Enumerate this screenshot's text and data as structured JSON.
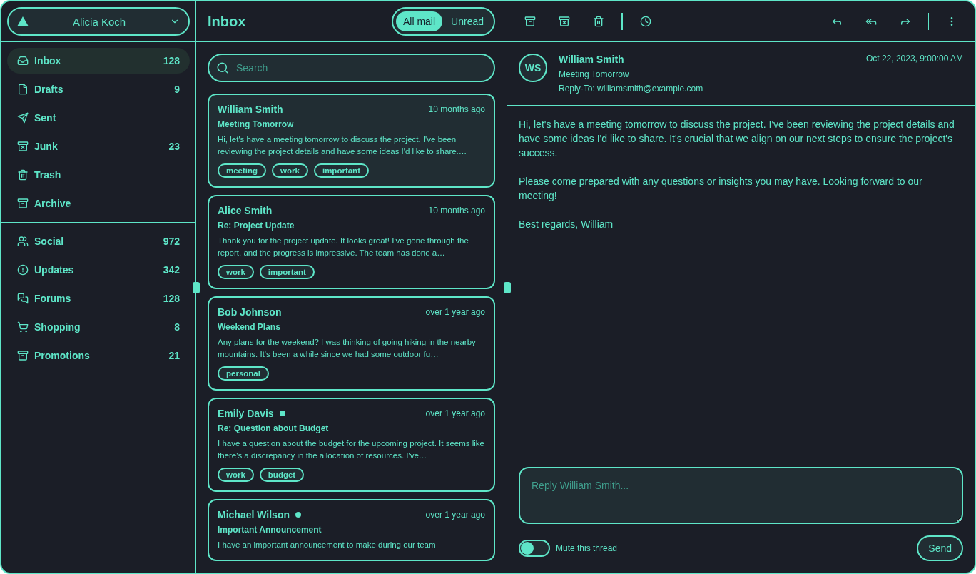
{
  "account": {
    "name": "Alicia Koch"
  },
  "nav_primary": [
    {
      "label": "Inbox",
      "count": "128",
      "selected": true
    },
    {
      "label": "Drafts",
      "count": "9",
      "selected": false
    },
    {
      "label": "Sent",
      "selected": false
    },
    {
      "label": "Junk",
      "count": "23",
      "selected": false
    },
    {
      "label": "Trash",
      "selected": false
    },
    {
      "label": "Archive",
      "selected": false
    }
  ],
  "nav_secondary": [
    {
      "label": "Social",
      "count": "972",
      "selected": false
    },
    {
      "label": "Updates",
      "count": "342",
      "selected": false
    },
    {
      "label": "Forums",
      "count": "128",
      "selected": false
    },
    {
      "label": "Shopping",
      "count": "8",
      "selected": false
    },
    {
      "label": "Promotions",
      "count": "21",
      "selected": false
    }
  ],
  "list": {
    "title": "Inbox",
    "tabs": [
      {
        "label": "All mail",
        "selected": true
      },
      {
        "label": "Unread",
        "selected": false
      }
    ],
    "search": {
      "placeholder": "Search"
    },
    "mails": [
      {
        "name": "William Smith",
        "unread": false,
        "selected": true,
        "time": "10 months ago",
        "subject": "Meeting Tomorrow",
        "preview": "Hi, let's have a meeting tomorrow to discuss the project. I've been reviewing the project details and have some ideas I'd like to share.…",
        "tags": [
          "meeting",
          "work",
          "important"
        ]
      },
      {
        "name": "Alice Smith",
        "unread": false,
        "selected": false,
        "time": "10 months ago",
        "subject": "Re: Project Update",
        "preview": "Thank you for the project update. It looks great! I've gone through the report, and the progress is impressive. The team has done a…",
        "tags": [
          "work",
          "important"
        ]
      },
      {
        "name": "Bob Johnson",
        "unread": false,
        "selected": false,
        "time": "over 1 year ago",
        "subject": "Weekend Plans",
        "preview": "Any plans for the weekend? I was thinking of going hiking in the nearby mountains. It's been a while since we had some outdoor fu…",
        "tags": [
          "personal"
        ]
      },
      {
        "name": "Emily Davis",
        "unread": true,
        "selected": false,
        "time": "over 1 year ago",
        "subject": "Re: Question about Budget",
        "preview": "I have a question about the budget for the upcoming project. It seems like there's a discrepancy in the allocation of resources. I've…",
        "tags": [
          "work",
          "budget"
        ]
      },
      {
        "name": "Michael Wilson",
        "unread": true,
        "selected": false,
        "time": "over 1 year ago",
        "subject": "Important Announcement",
        "preview": "I have an important announcement to make during our team"
      }
    ]
  },
  "detail": {
    "initials": "WS",
    "sender": "William Smith",
    "subject": "Meeting Tomorrow",
    "reply_to": "Reply-To: williamsmith@example.com",
    "date": "Oct 22, 2023, 9:00:00 AM",
    "body": [
      "Hi, let's have a meeting tomorrow to discuss the project. I've been reviewing the project details and have some ideas I'd like to share. It's crucial that we align on our next steps to ensure the project's success.",
      "Please come prepared with any questions or insights you may have. Looking forward to our meeting!",
      "Best regards, William"
    ],
    "reply": {
      "placeholder": "Reply William Smith..."
    },
    "mute": {
      "label": "Mute this thread",
      "on": false
    },
    "send": "Send"
  }
}
